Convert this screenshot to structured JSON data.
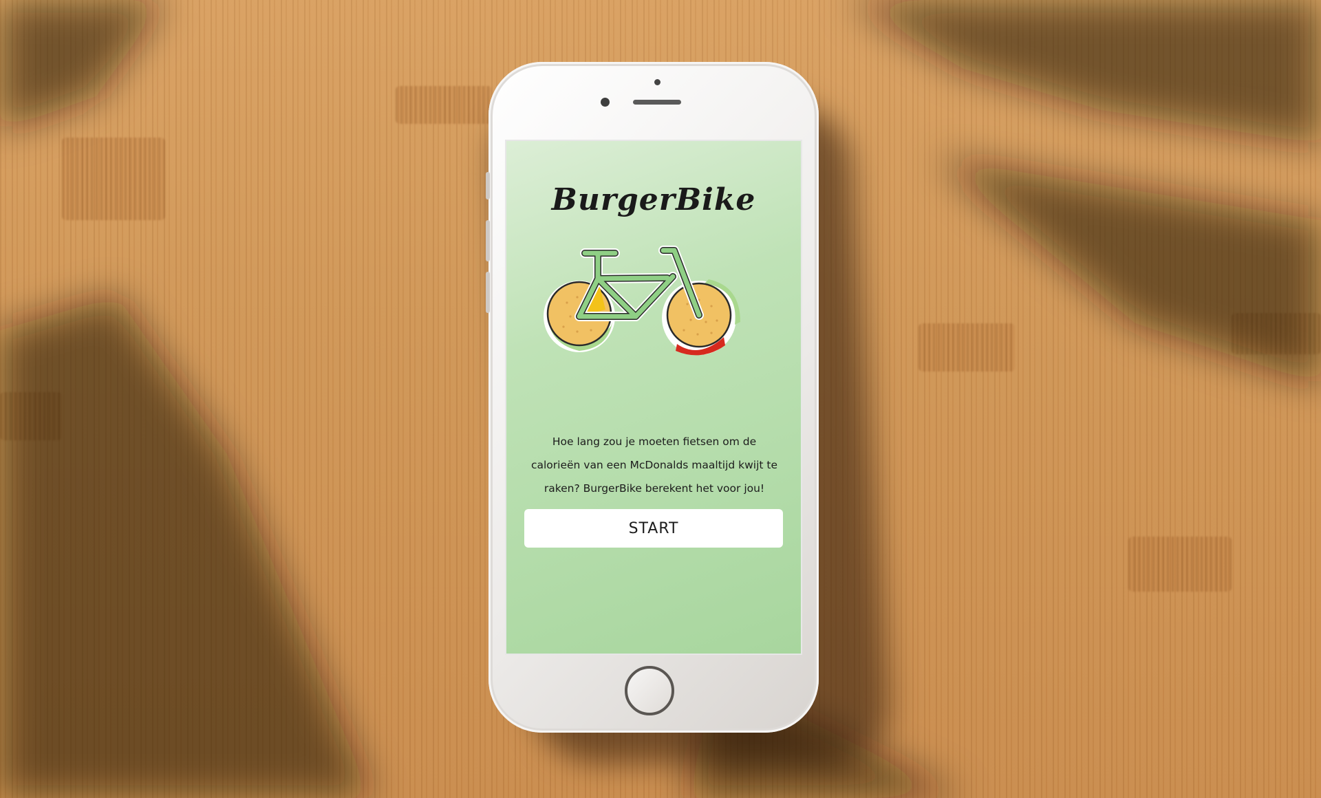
{
  "app": {
    "title": "BurgerBike",
    "intro": "Hoe lang zou je moeten fietsen om de calorieën van een McDonalds maaltijd kwijt te raken? BurgerBike berekent het voor jou!",
    "start_label": "START"
  },
  "icons": {
    "logo": "burger-bike-logo-icon",
    "home": "home-button-icon"
  },
  "colors": {
    "screen_top": "#dceed6",
    "screen_bottom": "#a8d69e",
    "bike_frame": "#8fcf85",
    "bun": "#f1c163",
    "lettuce": "#a9d88e",
    "tomato": "#d62a1e",
    "cheese": "#f3c21a",
    "wood": "#cf9555"
  }
}
